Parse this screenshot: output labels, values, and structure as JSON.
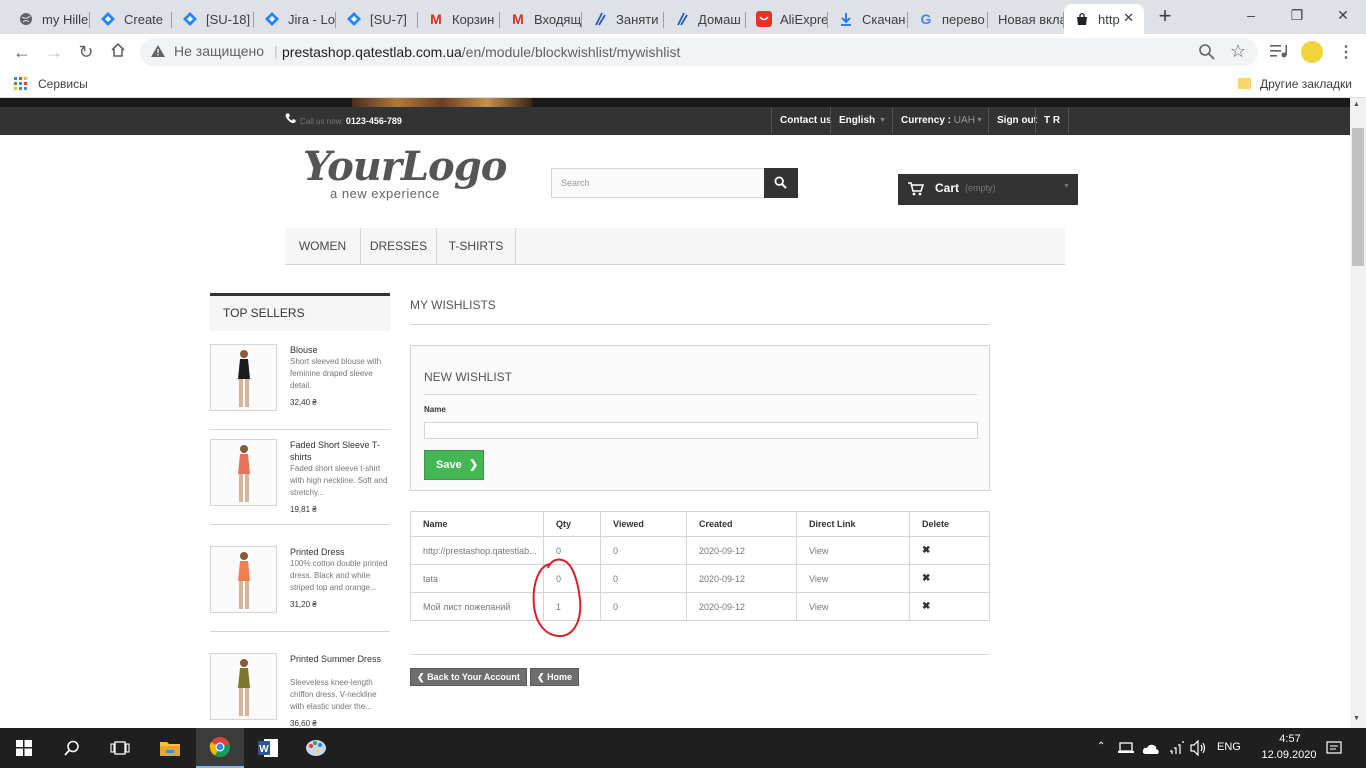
{
  "browser": {
    "tabs": [
      {
        "title": "my Hille",
        "icon": "globe-icon"
      },
      {
        "title": "Create",
        "icon": "jira-icon"
      },
      {
        "title": "[SU-18]",
        "icon": "jira-icon"
      },
      {
        "title": "Jira - Lo",
        "icon": "jira-icon"
      },
      {
        "title": "[SU-7]",
        "icon": "jira-icon"
      },
      {
        "title": "Корзин",
        "icon": "gmail-icon"
      },
      {
        "title": "Входящ",
        "icon": "gmail-icon"
      },
      {
        "title": "Заняти",
        "icon": "slash-icon"
      },
      {
        "title": "Домаш",
        "icon": "slash-icon"
      },
      {
        "title": "AliExpre",
        "icon": "aliexpress-icon"
      },
      {
        "title": "Скачан",
        "icon": "download-icon"
      },
      {
        "title": "перево",
        "icon": "google-icon"
      },
      {
        "title": "Новая вкла",
        "icon": "none"
      },
      {
        "title": "http",
        "icon": "shop-icon",
        "active": true
      }
    ],
    "security_label": "Не защищено",
    "url_host": "prestashop.qatestlab.com.ua",
    "url_path": "/en/module/blockwishlist/mywishlist",
    "bookmarks_apps": "Сервисы",
    "bookmarks_other": "Другие закладки"
  },
  "header": {
    "call_prefix": "Call us now:",
    "phone": "0123-456-789",
    "contact": "Contact us",
    "language": "English",
    "currency_label": "Currency :",
    "currency_value": "UAH",
    "sign_out": "Sign out",
    "user": "T R",
    "logo_main": "YourLogo",
    "logo_sub": "a new experience",
    "search_placeholder": "Search",
    "cart_label": "Cart",
    "cart_state": "(empty)"
  },
  "menu": [
    "WOMEN",
    "DRESSES",
    "T-SHIRTS"
  ],
  "sidebar": {
    "title": "TOP SELLERS",
    "products": [
      {
        "name": "Blouse",
        "desc": "Short sleeved blouse with feminine draped sleeve detail.",
        "price": "32,40 ₴"
      },
      {
        "name": "Faded Short Sleeve T-shirts",
        "desc": "Faded short sleeve t-shirt with high neckline. Soft and stretchy...",
        "price": "19,81 ₴"
      },
      {
        "name": "Printed Dress",
        "desc": "100% cotton double printed dress. Black and white striped top and orange...",
        "price": "31,20 ₴"
      },
      {
        "name": "Printed Summer Dress",
        "desc": "Sleeveless knee-length chiffon dress. V-neckline with elastic under the...",
        "price": "36,60 ₴"
      }
    ]
  },
  "main": {
    "title": "MY WISHLISTS",
    "new_title": "NEW WISHLIST",
    "name_label": "Name",
    "name_value": "",
    "save_label": "Save",
    "columns": [
      "Name",
      "Qty",
      "Viewed",
      "Created",
      "Direct Link",
      "Delete"
    ],
    "rows": [
      {
        "name": "http://prestashop.qatestlab...",
        "qty": "0",
        "viewed": "0",
        "created": "2020-09-12",
        "link": "View"
      },
      {
        "name": "tata",
        "qty": "0",
        "viewed": "0",
        "created": "2020-09-12",
        "link": "View"
      },
      {
        "name": "Мой лист пожеланий",
        "qty": "1",
        "viewed": "0",
        "created": "2020-09-12",
        "link": "View"
      }
    ],
    "back_account": "Back to Your Account",
    "home": "Home"
  },
  "taskbar": {
    "lang": "ENG",
    "time": "4:57",
    "date": "12.09.2020"
  },
  "colors": {
    "accent_green": "#43b754",
    "dark_bar": "#333333",
    "annotation_red": "#d9202a"
  }
}
